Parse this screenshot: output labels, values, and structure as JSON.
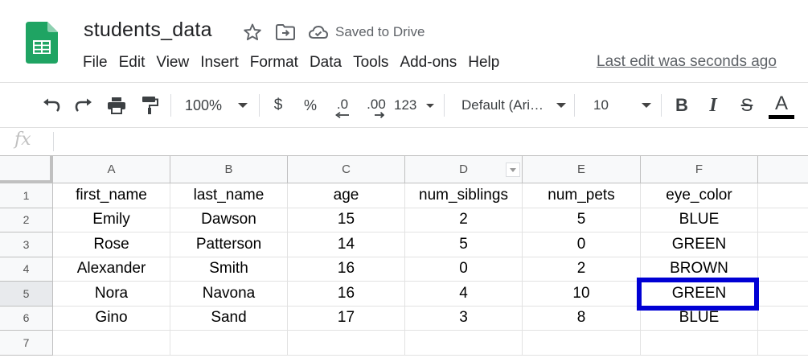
{
  "app": {
    "title": "students_data",
    "saved_status": "Saved to Drive",
    "last_edit": "Last edit was seconds ago",
    "logo_icon": "google-sheets-logo",
    "colors": {
      "logo_green": "#1fa463",
      "selection_blue": "#0000d4"
    }
  },
  "menu": [
    "File",
    "Edit",
    "View",
    "Insert",
    "Format",
    "Data",
    "Tools",
    "Add-ons",
    "Help"
  ],
  "toolbar": {
    "zoom": "100%",
    "currency": "$",
    "percent": "%",
    "decrease_decimal": ".0",
    "increase_decimal": ".00",
    "more_formats": "123",
    "font_family": "Default (Ari…",
    "font_size": "10",
    "bold": "B",
    "italic": "I",
    "strikethrough": "S",
    "text_color": "A"
  },
  "formula_bar": {
    "fx": "fx",
    "value": ""
  },
  "sheet": {
    "columns": [
      "A",
      "B",
      "C",
      "D",
      "E",
      "F"
    ],
    "rows": [
      {
        "num": "1",
        "cells": [
          "first_name",
          "last_name",
          "age",
          "num_siblings",
          "num_pets",
          "eye_color"
        ]
      },
      {
        "num": "2",
        "cells": [
          "Emily",
          "Dawson",
          "15",
          "2",
          "5",
          "BLUE"
        ]
      },
      {
        "num": "3",
        "cells": [
          "Rose",
          "Patterson",
          "14",
          "5",
          "0",
          "GREEN"
        ]
      },
      {
        "num": "4",
        "cells": [
          "Alexander",
          "Smith",
          "16",
          "0",
          "2",
          "BROWN"
        ]
      },
      {
        "num": "5",
        "cells": [
          "Nora",
          "Navona",
          "16",
          "4",
          "10",
          "GREEN"
        ]
      },
      {
        "num": "6",
        "cells": [
          "Gino",
          "Sand",
          "17",
          "3",
          "8",
          "BLUE"
        ]
      },
      {
        "num": "7",
        "cells": [
          "",
          "",
          "",
          "",
          "",
          ""
        ]
      }
    ],
    "selected_cell": "F5"
  }
}
